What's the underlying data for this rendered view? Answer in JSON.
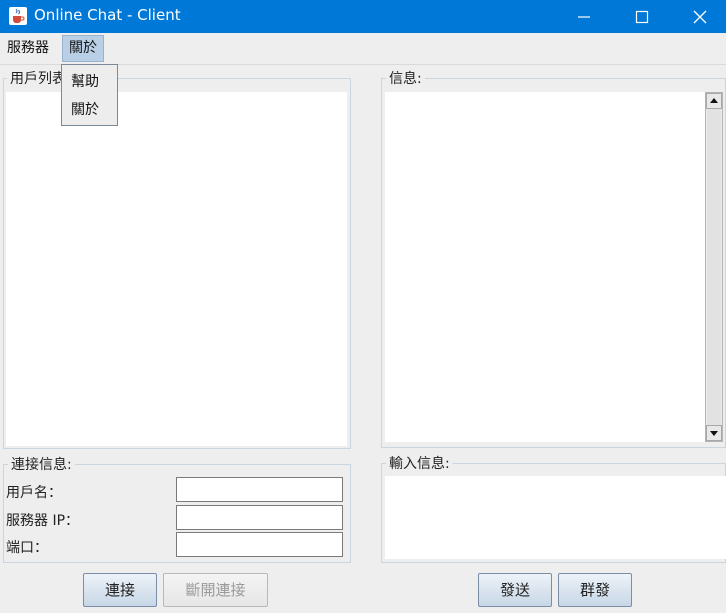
{
  "window": {
    "title": "Online Chat - Client",
    "icon": "java-coffee-cup-icon",
    "controls": [
      "minimize-icon",
      "maximize-icon",
      "close-icon"
    ],
    "titlebar_color": "#0078d7"
  },
  "menubar": {
    "items": [
      {
        "label": "服務器"
      },
      {
        "label": "關於",
        "open": true
      }
    ]
  },
  "about_menu": {
    "items": [
      {
        "label": "幫助"
      },
      {
        "label": "關於"
      }
    ]
  },
  "user_list": {
    "title": "用戶列表"
  },
  "messages": {
    "title": "信息:",
    "scrollbar_icons": [
      "scroll-up-arrow-icon",
      "scroll-down-arrow-icon"
    ]
  },
  "connection_info": {
    "title": "連接信息:",
    "fields": [
      {
        "label": "用戶名：",
        "value": ""
      },
      {
        "label": "服務器 IP：",
        "value": ""
      },
      {
        "label": "端口：",
        "value": ""
      }
    ]
  },
  "input_message": {
    "title": "輸入信息:"
  },
  "buttons": {
    "connect": "連接",
    "disconnect": "斷開連接",
    "disconnect_enabled": false,
    "send": "發送",
    "group_send": "群發"
  }
}
